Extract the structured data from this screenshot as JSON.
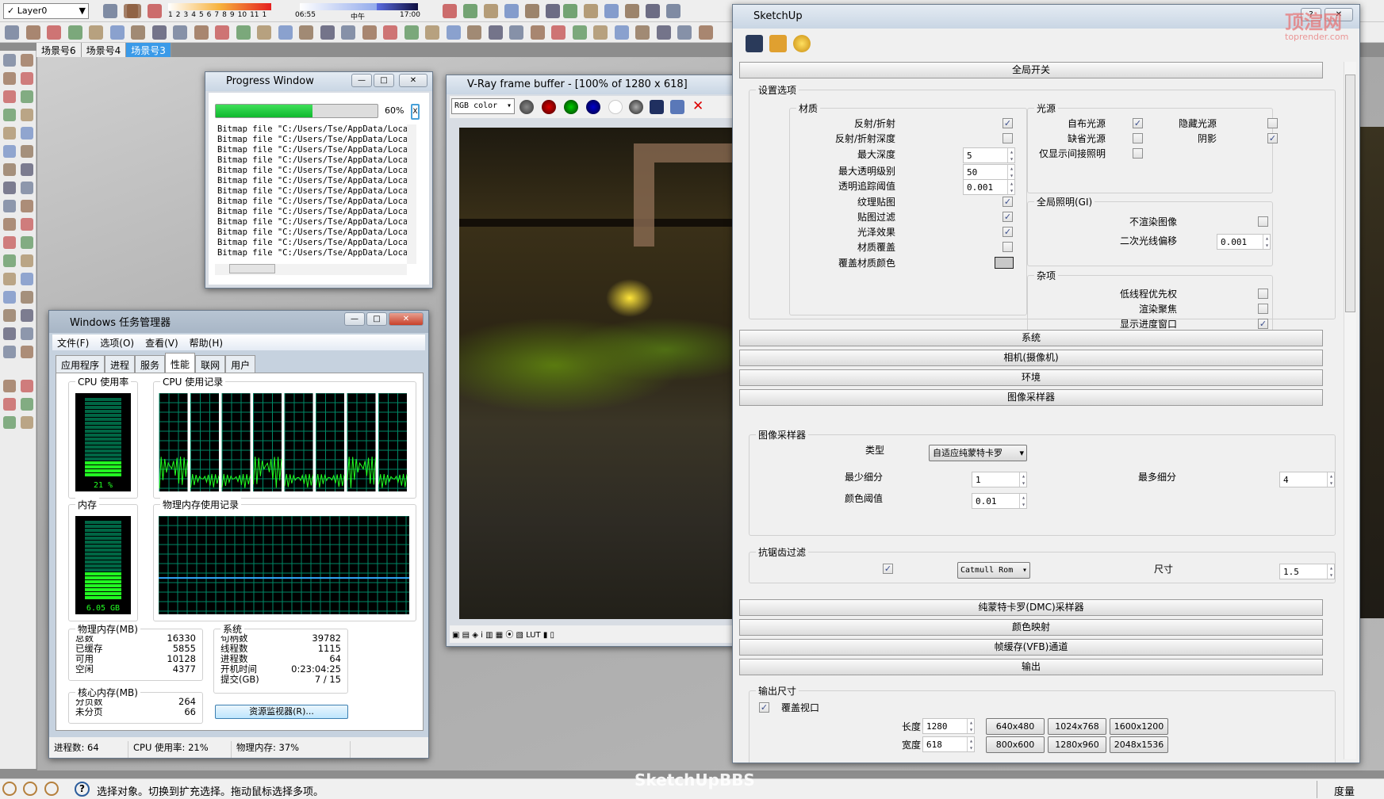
{
  "toolbar": {
    "layer": "Layer0",
    "months": [
      "1",
      "2",
      "3",
      "4",
      "5",
      "6",
      "7",
      "8",
      "9",
      "10",
      "11",
      "1"
    ],
    "time_start": "06:55",
    "noon": "中午",
    "time_end": "17:00"
  },
  "scene_tabs": [
    {
      "label": "场景号6",
      "active": false
    },
    {
      "label": "场景号4",
      "active": false
    },
    {
      "label": "场景号3",
      "active": true
    }
  ],
  "status": {
    "hint": "选择对象。切换到扩充选择。拖动鼠标选择多项。",
    "measure": "度量"
  },
  "watermark": {
    "top": "顶渲网",
    "top_sub": "toprender.com",
    "bottom": "SketchUpBBS"
  },
  "progress": {
    "title": "Progress Window",
    "percent": 60,
    "percent_label": "60%",
    "close": "X",
    "log": [
      "Bitmap file \"C:/Users/Tse/AppData/Local",
      "Bitmap file \"C:/Users/Tse/AppData/Local",
      "Bitmap file \"C:/Users/Tse/AppData/Local",
      "Bitmap file \"C:/Users/Tse/AppData/Local",
      "Bitmap file \"C:/Users/Tse/AppData/Local",
      "Bitmap file \"C:/Users/Tse/AppData/Local",
      "Bitmap file \"C:/Users/Tse/AppData/Local",
      "Bitmap file \"C:/Users/Tse/AppData/Local",
      "Bitmap file \"C:/Users/Tse/AppData/Local",
      "Bitmap file \"C:/Users/Tse/AppData/Local",
      "Bitmap file \"C:/Users/Tse/AppData/Local",
      "Bitmap file \"C:/Users/Tse/AppData/Local",
      "Bitmap file \"C:/Users/Tse/AppData/Local"
    ]
  },
  "vfb": {
    "title": "V-Ray frame buffer - [100% of 1280 x 618]",
    "channel": "RGB color"
  },
  "taskmgr": {
    "title": "Windows 任务管理器",
    "menu": [
      "文件(F)",
      "选项(O)",
      "查看(V)",
      "帮助(H)"
    ],
    "tabs": [
      {
        "label": "应用程序",
        "active": false
      },
      {
        "label": "进程",
        "active": false
      },
      {
        "label": "服务",
        "active": false
      },
      {
        "label": "性能",
        "active": true
      },
      {
        "label": "联网",
        "active": false
      },
      {
        "label": "用户",
        "active": false
      }
    ],
    "cpu_label": "CPU 使用率",
    "cpu_value": "21 %",
    "cpu_percent": 21,
    "cpu_history_label": "CPU 使用记录",
    "mem_label": "内存",
    "mem_value": "6.05 GB",
    "mem_percent": 37,
    "mem_history_label": "物理内存使用记录",
    "physical": {
      "title": "物理内存(MB)",
      "rows": [
        [
          "总数",
          "16330"
        ],
        [
          "已缓存",
          "5855"
        ],
        [
          "可用",
          "10128"
        ],
        [
          "空闲",
          "4377"
        ]
      ]
    },
    "kernel": {
      "title": "核心内存(MB)",
      "rows": [
        [
          "分页数",
          "264"
        ],
        [
          "未分页",
          "66"
        ]
      ]
    },
    "system": {
      "title": "系统",
      "rows": [
        [
          "句柄数",
          "39782"
        ],
        [
          "线程数",
          "1115"
        ],
        [
          "进程数",
          "64"
        ],
        [
          "开机时间",
          "0:23:04:25"
        ],
        [
          "提交(GB)",
          "7 / 15"
        ]
      ]
    },
    "resmon": "资源监视器(R)...",
    "statusbar": [
      "进程数: 64",
      "CPU 使用率: 21%",
      "物理内存: 37%"
    ]
  },
  "su": {
    "title": "SketchUp",
    "help": "?",
    "global_header": "全局开关",
    "settings_label": "设置选项",
    "material": {
      "title": "材质",
      "rows": [
        {
          "label": "反射/折射",
          "type": "check",
          "checked": true
        },
        {
          "label": "反射/折射深度",
          "type": "check",
          "checked": false
        },
        {
          "label": "最大深度",
          "type": "spin",
          "value": "5"
        },
        {
          "label": "最大透明级别",
          "type": "spin",
          "value": "50"
        },
        {
          "label": "透明追踪阈值",
          "type": "spin",
          "value": "0.001"
        },
        {
          "label": "纹理贴图",
          "type": "check",
          "checked": true
        },
        {
          "label": "贴图过滤",
          "type": "check",
          "checked": true
        },
        {
          "label": "光泽效果",
          "type": "check",
          "checked": true
        },
        {
          "label": "材质覆盖",
          "type": "check",
          "checked": false
        },
        {
          "label": "覆盖材质颜色",
          "type": "color",
          "value": "#c8c8c8"
        }
      ]
    },
    "lights": {
      "title": "光源",
      "items": [
        {
          "label": "自布光源",
          "checked": true
        },
        {
          "label": "隐藏光源",
          "checked": false
        },
        {
          "label": "缺省光源",
          "checked": false
        },
        {
          "label": "阴影",
          "checked": true
        },
        {
          "label": "仅显示间接照明",
          "checked": false
        }
      ]
    },
    "gi": {
      "title": "全局照明(GI)",
      "dont_render": "不渲染图像",
      "dont_render_checked": false,
      "secondary_bias": "二次光线偏移",
      "secondary_bias_value": "0.001"
    },
    "misc": {
      "title": "杂项",
      "items": [
        {
          "label": "低线程优先权",
          "checked": false
        },
        {
          "label": "渲染聚焦",
          "checked": false
        },
        {
          "label": "显示进度窗口",
          "checked": true
        }
      ]
    },
    "headers": [
      "系统",
      "相机(摄像机)",
      "环境",
      "图像采样器"
    ],
    "sampler": {
      "title": "图像采样器",
      "type_label": "类型",
      "type_value": "自适应纯蒙特卡罗",
      "min_label": "最少细分",
      "min_value": "1",
      "max_label": "最多细分",
      "max_value": "4",
      "thresh_label": "颜色阈值",
      "thresh_value": "0.01"
    },
    "aa": {
      "title": "抗锯齿过滤",
      "enabled": true,
      "filter": "Catmull Rom",
      "size_label": "尺寸",
      "size_value": "1.5"
    },
    "headers2": [
      "纯蒙特卡罗(DMC)采样器",
      "颜色映射",
      "帧缓存(VFB)通道",
      "输出"
    ],
    "output": {
      "title": "输出尺寸",
      "override_label": "覆盖视口",
      "override_checked": true,
      "width_label": "长度",
      "width_value": "1280",
      "height_label": "宽度",
      "height_value": "618",
      "presets": [
        "640x480",
        "1024x768",
        "1600x1200",
        "800x600",
        "1280x960",
        "2048x1536"
      ]
    }
  }
}
